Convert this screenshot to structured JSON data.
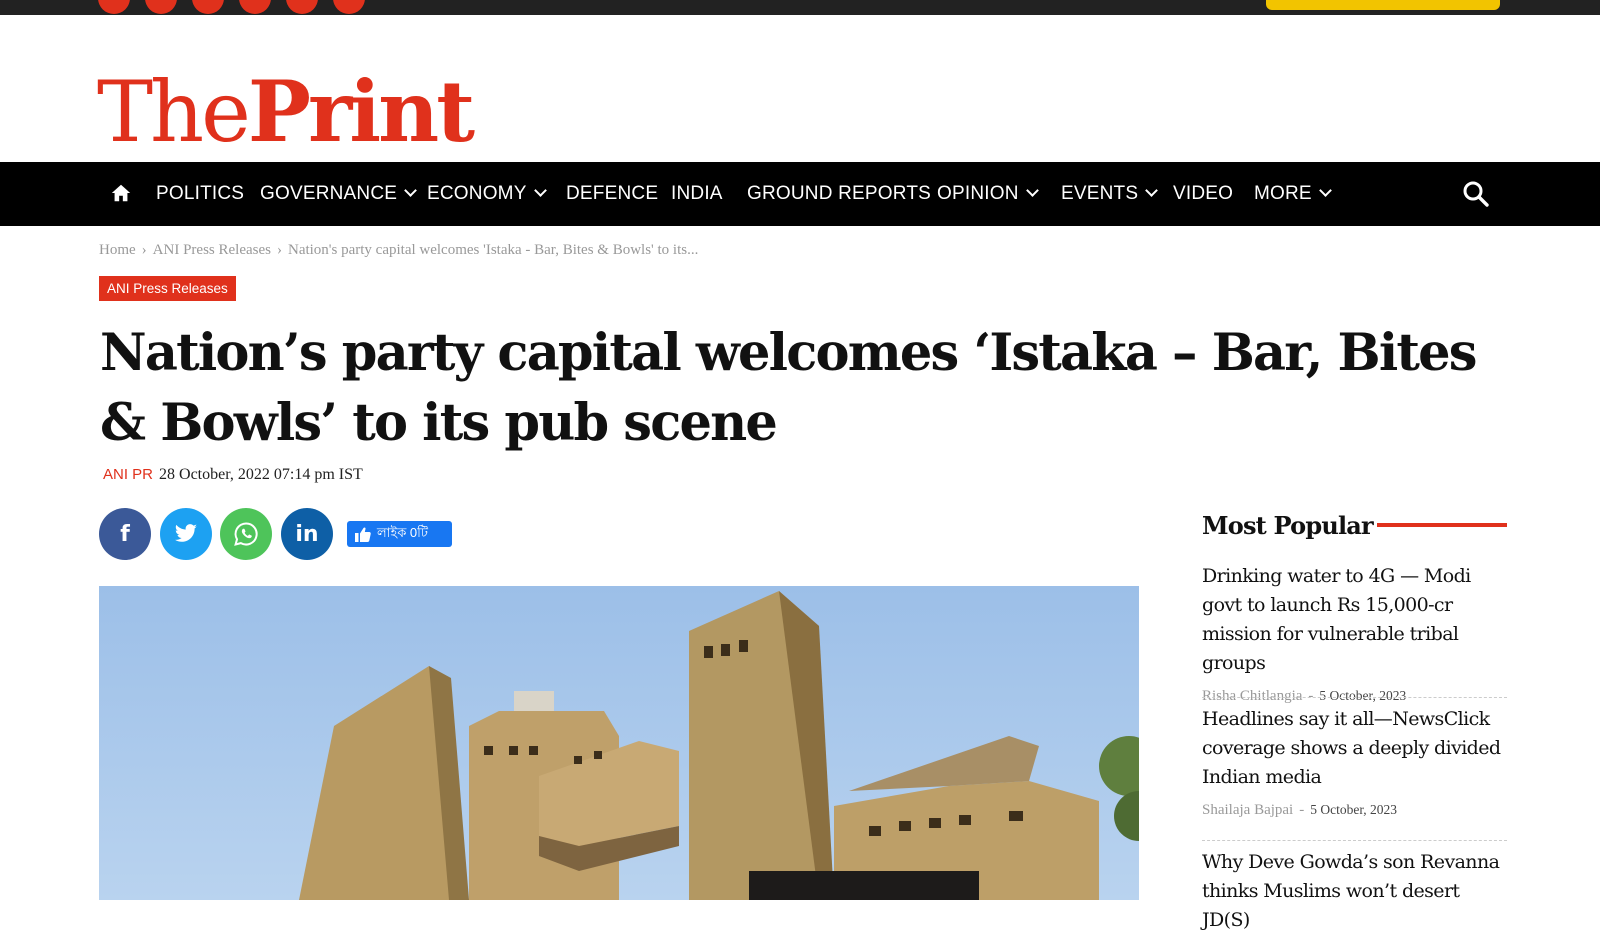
{
  "site": {
    "logo_the": "The",
    "logo_print": "Print",
    "accent": "#e0311c"
  },
  "nav": {
    "items": [
      "POLITICS",
      "GOVERNANCE",
      "ECONOMY",
      "DEFENCE",
      "INDIA",
      "GROUND REPORTS",
      "OPINION",
      "EVENTS",
      "VIDEO",
      "MORE"
    ],
    "icons": [
      "home-icon",
      "search-icon"
    ]
  },
  "breadcrumb": {
    "home": "Home",
    "sep": "›",
    "category": "ANI Press Releases",
    "current": "Nation's party capital welcomes 'Istaka - Bar, Bites & Bowls' to its..."
  },
  "article": {
    "category": "ANI Press Releases",
    "title": "Nation’s party capital welcomes ‘Istaka – Bar, Bites & Bowls’ to its pub scene",
    "author": "ANI PR",
    "date": "28 October, 2022 07:14 pm IST"
  },
  "share": {
    "facebook": "f",
    "linkedin": "in",
    "like_label": "লাইক 0টি"
  },
  "sidebar": {
    "title": "Most Popular",
    "items": [
      {
        "title": "Drinking water to 4G — Modi govt to launch Rs 15,000-cr mission for vulnerable tribal groups",
        "author": "Risha Chitlangia",
        "sep": "-",
        "date": "5 October, 2023"
      },
      {
        "title": "Headlines say it all—NewsClick coverage shows a deeply divided Indian media",
        "author": "Shailaja Bajpai",
        "sep": "-",
        "date": "5 October, 2023"
      },
      {
        "title": "Why Deve Gowda’s son Revanna thinks Muslims won’t desert JD(S)"
      }
    ]
  }
}
